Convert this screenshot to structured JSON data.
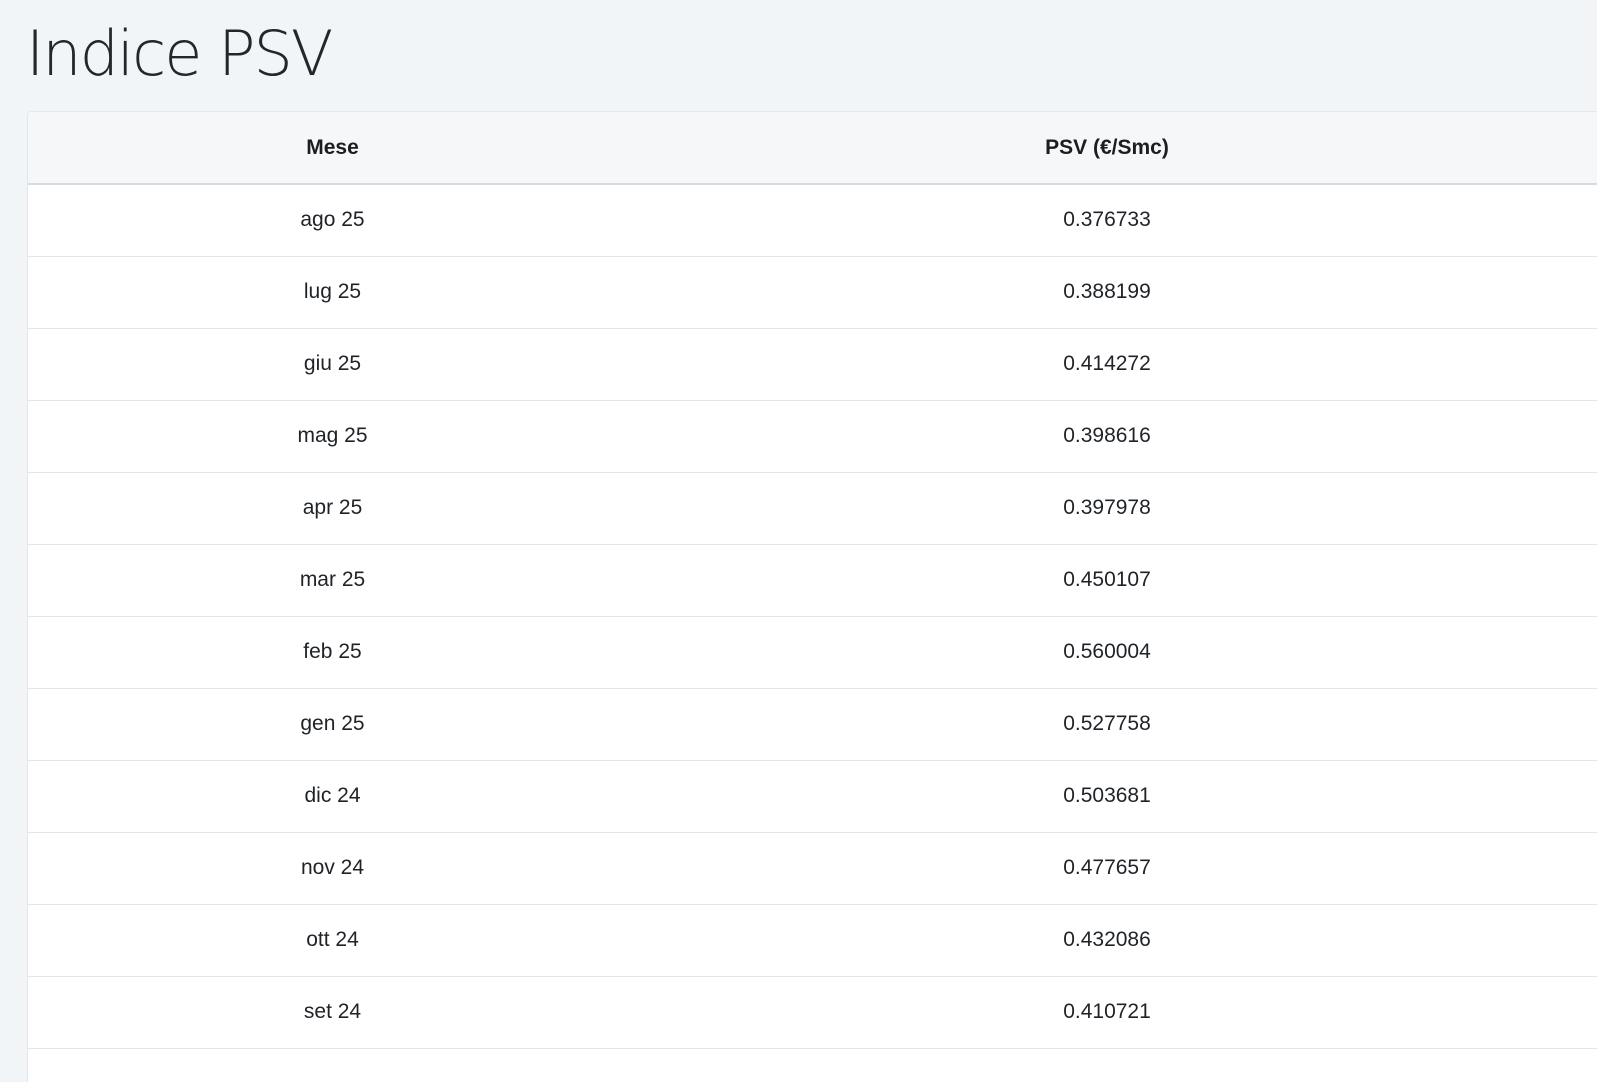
{
  "page": {
    "title": "Indice PSV"
  },
  "table": {
    "headers": {
      "month": "Mese",
      "psv": "PSV (€/Smc)"
    },
    "rows": [
      {
        "month": "ago 25",
        "psv": "0.376733"
      },
      {
        "month": "lug 25",
        "psv": "0.388199"
      },
      {
        "month": "giu 25",
        "psv": "0.414272"
      },
      {
        "month": "mag 25",
        "psv": "0.398616"
      },
      {
        "month": "apr 25",
        "psv": "0.397978"
      },
      {
        "month": "mar 25",
        "psv": "0.450107"
      },
      {
        "month": "feb 25",
        "psv": "0.560004"
      },
      {
        "month": "gen 25",
        "psv": "0.527758"
      },
      {
        "month": "dic 24",
        "psv": "0.503681"
      },
      {
        "month": "nov 24",
        "psv": "0.477657"
      },
      {
        "month": "ott 24",
        "psv": "0.432086"
      },
      {
        "month": "set 24",
        "psv": "0.410721"
      }
    ]
  }
}
